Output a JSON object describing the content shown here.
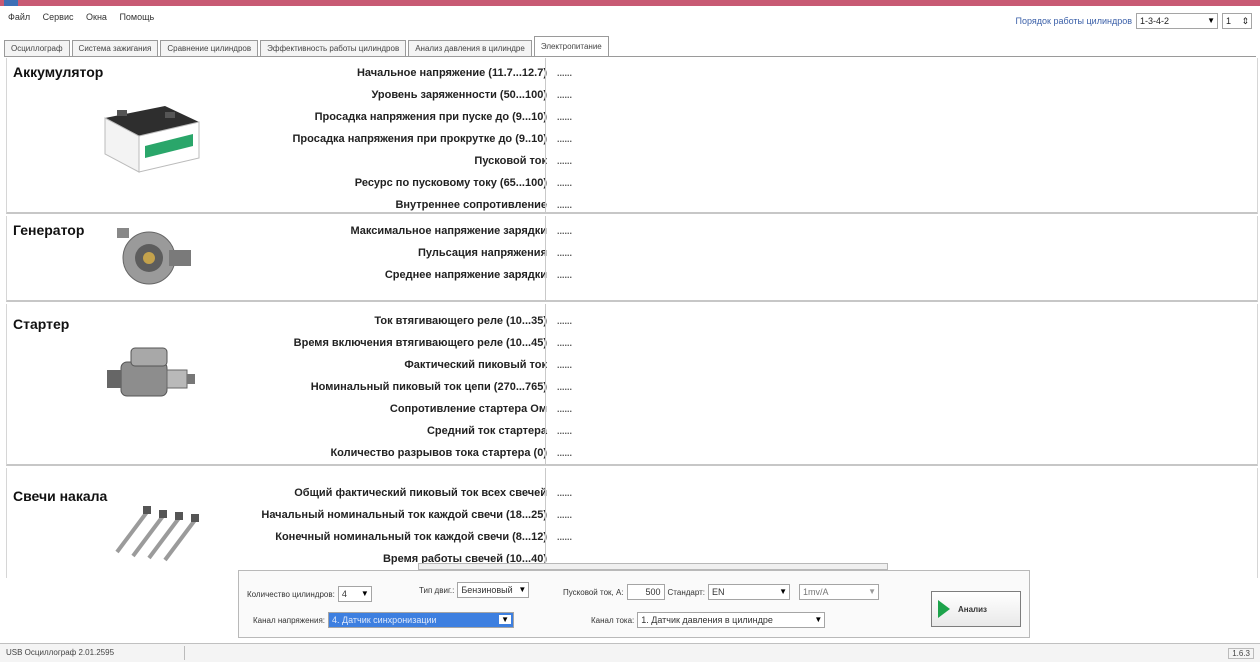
{
  "menu": [
    "Файл",
    "Сервис",
    "Окна",
    "Помощь"
  ],
  "firing_order": {
    "label": "Порядок работы цилиндров",
    "value": "1-3-4-2",
    "spin_value": "1"
  },
  "tabs": [
    {
      "label": "Осциллограф"
    },
    {
      "label": "Система зажигания"
    },
    {
      "label": "Сравнение цилиндров"
    },
    {
      "label": "Эффективность работы цилиндров"
    },
    {
      "label": "Анализ давления в цилиндре"
    },
    {
      "label": "Электропитание",
      "active": true
    }
  ],
  "sections": {
    "battery": {
      "title": "Аккумулятор",
      "rows": [
        {
          "label": "Начальное напряжение (11.7...12.7)",
          "value": "......"
        },
        {
          "label": "Уровень заряженности (50...100)",
          "value": "......"
        },
        {
          "label": "Просадка напряжения при пуске до (9...10)",
          "value": "......"
        },
        {
          "label": "Просадка напряжения при прокрутке до (9..10)",
          "value": "......"
        },
        {
          "label": "Пусковой ток",
          "value": "......"
        },
        {
          "label": "Ресурс по пусковому току (65...100)",
          "value": "......"
        },
        {
          "label": "Внутреннее сопротивление",
          "value": "......"
        }
      ]
    },
    "generator": {
      "title": "Генератор",
      "rows": [
        {
          "label": "Максимальное напряжение зарядки",
          "value": "......"
        },
        {
          "label": "Пульсация напряжения",
          "value": "......"
        },
        {
          "label": "Среднее напряжение зарядки",
          "value": "......"
        }
      ]
    },
    "starter": {
      "title": "Стартер",
      "rows": [
        {
          "label": "Ток втягивающего реле (10...35)",
          "value": "......"
        },
        {
          "label": "Время включения втягивающего реле (10...45)",
          "value": "......"
        },
        {
          "label": "Фактический пиковый ток",
          "value": "......"
        },
        {
          "label": "Номинальный пиковый ток цепи (270...765)",
          "value": "......"
        },
        {
          "label": "Сопротивление стартера Ом",
          "value": "......"
        },
        {
          "label": "Средний ток стартера",
          "value": "......"
        },
        {
          "label": "Количество разрывов тока стартера (0)",
          "value": "......"
        }
      ]
    },
    "glow_plugs": {
      "title": "Свечи накала",
      "rows": [
        {
          "label": "Общий фактический пиковый ток всех свечей",
          "value": "......"
        },
        {
          "label": "Начальный номинальный ток каждой свечи (18...25)",
          "value": "......"
        },
        {
          "label": "Конечный номинальный ток каждой свечи (8...12)",
          "value": "......"
        },
        {
          "label": "Время работы свечей (10...40)",
          "value": ""
        }
      ]
    }
  },
  "controls": {
    "cylinders_label": "Количество цилиндров:",
    "cylinders_value": "4",
    "engine_type_label": "Тип двиг.:",
    "engine_type_value": "Бензиновый",
    "voltage_channel_label": "Канал напряжения:",
    "voltage_channel_value": "4. Датчик синхронизации",
    "start_current_label": "Пусковой ток, А:",
    "start_current_value": "500",
    "standard_label": "Стандарт:",
    "standard_value": "EN",
    "scale_value": "1mv/A",
    "current_channel_label": "Канал тока:",
    "current_channel_value": "1. Датчик давления в цилиндре",
    "analyze_label": "Анализ"
  },
  "status": {
    "left": "USB Осциллограф  2.01.2595",
    "right": "1.6.3"
  },
  "colors": {
    "title_bar": "#c85a74",
    "accent_blue": "#3a5fa8",
    "play_green": "#1da34b"
  }
}
